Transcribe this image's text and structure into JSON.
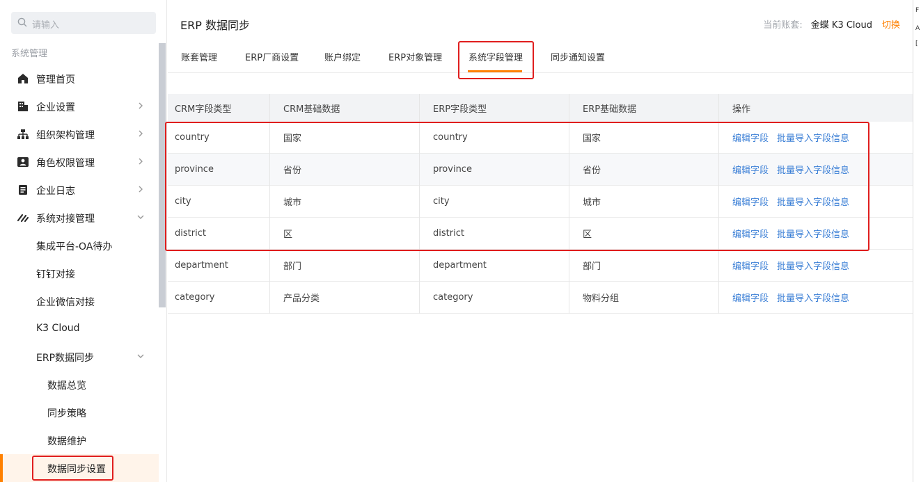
{
  "sidebar": {
    "search_placeholder": "请输入",
    "section_title": "系统管理",
    "items": [
      {
        "label": "管理首页",
        "icon": "home-icon"
      },
      {
        "label": "企业设置",
        "icon": "building-icon"
      },
      {
        "label": "组织架构管理",
        "icon": "org-chart-icon"
      },
      {
        "label": "角色权限管理",
        "icon": "id-card-icon"
      },
      {
        "label": "企业日志",
        "icon": "document-icon"
      },
      {
        "label": "系统对接管理",
        "icon": "link-icon"
      }
    ],
    "sub_items": [
      "集成平台-OA待办",
      "钉钉对接",
      "企业微信对接",
      "K3 Cloud",
      "ERP数据同步"
    ],
    "sub_sub_items": [
      "数据总览",
      "同步策略",
      "数据维护",
      "数据同步设置"
    ]
  },
  "header": {
    "title": "ERP 数据同步",
    "account_label": "当前账套:",
    "account_value": "金蝶 K3 Cloud",
    "switch_label": "切换"
  },
  "tabs": [
    "账套管理",
    "ERP厂商设置",
    "账户绑定",
    "ERP对象管理",
    "系统字段管理",
    "同步通知设置"
  ],
  "active_tab": "系统字段管理",
  "table": {
    "columns": [
      "CRM字段类型",
      "CRM基础数据",
      "ERP字段类型",
      "ERP基础数据",
      "操作"
    ],
    "rows": [
      [
        "country",
        "国家",
        "country",
        "国家"
      ],
      [
        "province",
        "省份",
        "province",
        "省份"
      ],
      [
        "city",
        "城市",
        "city",
        "城市"
      ],
      [
        "district",
        "区",
        "district",
        "区"
      ],
      [
        "department",
        "部门",
        "department",
        "部门"
      ],
      [
        "category",
        "产品分类",
        "category",
        "物料分组"
      ]
    ],
    "actions": [
      "编辑字段",
      "批量导入字段信息"
    ]
  },
  "edge_glyphs": [
    "F",
    "A",
    "["
  ],
  "colors": {
    "accent": "#ff8000",
    "link": "#3b7fd6",
    "highlight": "#e01e1e"
  }
}
